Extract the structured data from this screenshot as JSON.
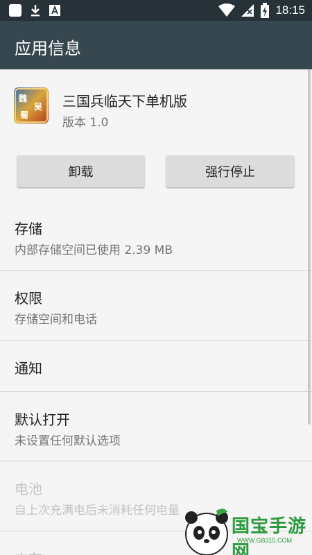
{
  "status_bar": {
    "time": "18:15",
    "left_icons": [
      "square-notification-icon",
      "download-icon",
      "a-notification-icon"
    ],
    "right_icons": [
      "wifi-icon",
      "signal-icon",
      "battery-charging-icon"
    ]
  },
  "app_bar": {
    "title": "应用信息"
  },
  "app": {
    "name": "三国兵临天下单机版",
    "version": "版本 1.0",
    "icon_chars": [
      "魏",
      "吴",
      "蜀"
    ]
  },
  "buttons": {
    "uninstall": "卸载",
    "force_stop": "强行停止"
  },
  "items": [
    {
      "title": "存储",
      "subtitle": "内部存储空间已使用 2.39 MB"
    },
    {
      "title": "权限",
      "subtitle": "存储空间和电话"
    },
    {
      "title": "通知"
    },
    {
      "title": "默认打开",
      "subtitle": "未设置任何默认选项"
    },
    {
      "title": "电池",
      "subtitle": "自上次充满电后未消耗任何电量"
    },
    {
      "title": "内存"
    }
  ],
  "watermark": {
    "text": "国宝手游网",
    "url": "WWW.GB315.COM"
  },
  "colors": {
    "status_bar": "#263238",
    "app_bar": "#37474f",
    "background": "#f5f5f5",
    "watermark": "#2a9a3c"
  }
}
